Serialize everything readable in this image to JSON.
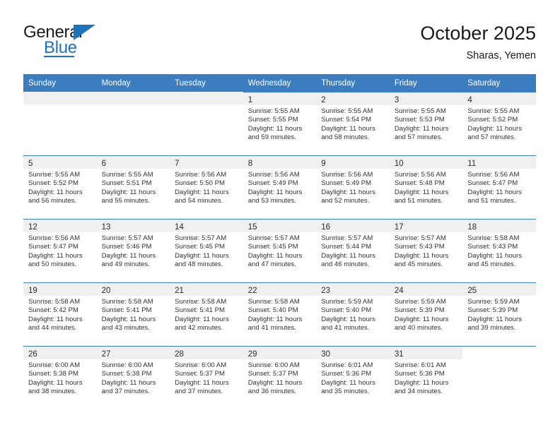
{
  "brand": {
    "name_top": "General",
    "name_bottom": "Blue",
    "accent_color": "#1f71b8",
    "flag_icon": "triangle-flag-icon"
  },
  "header": {
    "month_title": "October 2025",
    "location": "Sharas, Yemen"
  },
  "calendar": {
    "header_bg": "#3b7dbf",
    "daynum_band_bg": "#f0f0f0",
    "weekdays": [
      "Sunday",
      "Monday",
      "Tuesday",
      "Wednesday",
      "Thursday",
      "Friday",
      "Saturday"
    ],
    "weeks": [
      [
        {
          "blank": true
        },
        {
          "blank": true
        },
        {
          "blank": true
        },
        {
          "day": "1",
          "sunrise": "Sunrise: 5:55 AM",
          "sunset": "Sunset: 5:55 PM",
          "daylight": "Daylight: 11 hours and 59 minutes."
        },
        {
          "day": "2",
          "sunrise": "Sunrise: 5:55 AM",
          "sunset": "Sunset: 5:54 PM",
          "daylight": "Daylight: 11 hours and 58 minutes."
        },
        {
          "day": "3",
          "sunrise": "Sunrise: 5:55 AM",
          "sunset": "Sunset: 5:53 PM",
          "daylight": "Daylight: 11 hours and 57 minutes."
        },
        {
          "day": "4",
          "sunrise": "Sunrise: 5:55 AM",
          "sunset": "Sunset: 5:52 PM",
          "daylight": "Daylight: 11 hours and 57 minutes."
        }
      ],
      [
        {
          "day": "5",
          "sunrise": "Sunrise: 5:55 AM",
          "sunset": "Sunset: 5:52 PM",
          "daylight": "Daylight: 11 hours and 56 minutes."
        },
        {
          "day": "6",
          "sunrise": "Sunrise: 5:55 AM",
          "sunset": "Sunset: 5:51 PM",
          "daylight": "Daylight: 11 hours and 55 minutes."
        },
        {
          "day": "7",
          "sunrise": "Sunrise: 5:56 AM",
          "sunset": "Sunset: 5:50 PM",
          "daylight": "Daylight: 11 hours and 54 minutes."
        },
        {
          "day": "8",
          "sunrise": "Sunrise: 5:56 AM",
          "sunset": "Sunset: 5:49 PM",
          "daylight": "Daylight: 11 hours and 53 minutes."
        },
        {
          "day": "9",
          "sunrise": "Sunrise: 5:56 AM",
          "sunset": "Sunset: 5:49 PM",
          "daylight": "Daylight: 11 hours and 52 minutes."
        },
        {
          "day": "10",
          "sunrise": "Sunrise: 5:56 AM",
          "sunset": "Sunset: 5:48 PM",
          "daylight": "Daylight: 11 hours and 51 minutes."
        },
        {
          "day": "11",
          "sunrise": "Sunrise: 5:56 AM",
          "sunset": "Sunset: 5:47 PM",
          "daylight": "Daylight: 11 hours and 51 minutes."
        }
      ],
      [
        {
          "day": "12",
          "sunrise": "Sunrise: 5:56 AM",
          "sunset": "Sunset: 5:47 PM",
          "daylight": "Daylight: 11 hours and 50 minutes."
        },
        {
          "day": "13",
          "sunrise": "Sunrise: 5:57 AM",
          "sunset": "Sunset: 5:46 PM",
          "daylight": "Daylight: 11 hours and 49 minutes."
        },
        {
          "day": "14",
          "sunrise": "Sunrise: 5:57 AM",
          "sunset": "Sunset: 5:45 PM",
          "daylight": "Daylight: 11 hours and 48 minutes."
        },
        {
          "day": "15",
          "sunrise": "Sunrise: 5:57 AM",
          "sunset": "Sunset: 5:45 PM",
          "daylight": "Daylight: 11 hours and 47 minutes."
        },
        {
          "day": "16",
          "sunrise": "Sunrise: 5:57 AM",
          "sunset": "Sunset: 5:44 PM",
          "daylight": "Daylight: 11 hours and 46 minutes."
        },
        {
          "day": "17",
          "sunrise": "Sunrise: 5:57 AM",
          "sunset": "Sunset: 5:43 PM",
          "daylight": "Daylight: 11 hours and 45 minutes."
        },
        {
          "day": "18",
          "sunrise": "Sunrise: 5:58 AM",
          "sunset": "Sunset: 5:43 PM",
          "daylight": "Daylight: 11 hours and 45 minutes."
        }
      ],
      [
        {
          "day": "19",
          "sunrise": "Sunrise: 5:58 AM",
          "sunset": "Sunset: 5:42 PM",
          "daylight": "Daylight: 11 hours and 44 minutes."
        },
        {
          "day": "20",
          "sunrise": "Sunrise: 5:58 AM",
          "sunset": "Sunset: 5:41 PM",
          "daylight": "Daylight: 11 hours and 43 minutes."
        },
        {
          "day": "21",
          "sunrise": "Sunrise: 5:58 AM",
          "sunset": "Sunset: 5:41 PM",
          "daylight": "Daylight: 11 hours and 42 minutes."
        },
        {
          "day": "22",
          "sunrise": "Sunrise: 5:58 AM",
          "sunset": "Sunset: 5:40 PM",
          "daylight": "Daylight: 11 hours and 41 minutes."
        },
        {
          "day": "23",
          "sunrise": "Sunrise: 5:59 AM",
          "sunset": "Sunset: 5:40 PM",
          "daylight": "Daylight: 11 hours and 41 minutes."
        },
        {
          "day": "24",
          "sunrise": "Sunrise: 5:59 AM",
          "sunset": "Sunset: 5:39 PM",
          "daylight": "Daylight: 11 hours and 40 minutes."
        },
        {
          "day": "25",
          "sunrise": "Sunrise: 5:59 AM",
          "sunset": "Sunset: 5:39 PM",
          "daylight": "Daylight: 11 hours and 39 minutes."
        }
      ],
      [
        {
          "day": "26",
          "sunrise": "Sunrise: 6:00 AM",
          "sunset": "Sunset: 5:38 PM",
          "daylight": "Daylight: 11 hours and 38 minutes."
        },
        {
          "day": "27",
          "sunrise": "Sunrise: 6:00 AM",
          "sunset": "Sunset: 5:38 PM",
          "daylight": "Daylight: 11 hours and 37 minutes."
        },
        {
          "day": "28",
          "sunrise": "Sunrise: 6:00 AM",
          "sunset": "Sunset: 5:37 PM",
          "daylight": "Daylight: 11 hours and 37 minutes."
        },
        {
          "day": "29",
          "sunrise": "Sunrise: 6:00 AM",
          "sunset": "Sunset: 5:37 PM",
          "daylight": "Daylight: 11 hours and 36 minutes."
        },
        {
          "day": "30",
          "sunrise": "Sunrise: 6:01 AM",
          "sunset": "Sunset: 5:36 PM",
          "daylight": "Daylight: 11 hours and 35 minutes."
        },
        {
          "day": "31",
          "sunrise": "Sunrise: 6:01 AM",
          "sunset": "Sunset: 5:36 PM",
          "daylight": "Daylight: 11 hours and 34 minutes."
        },
        {
          "blank": true
        }
      ]
    ]
  }
}
